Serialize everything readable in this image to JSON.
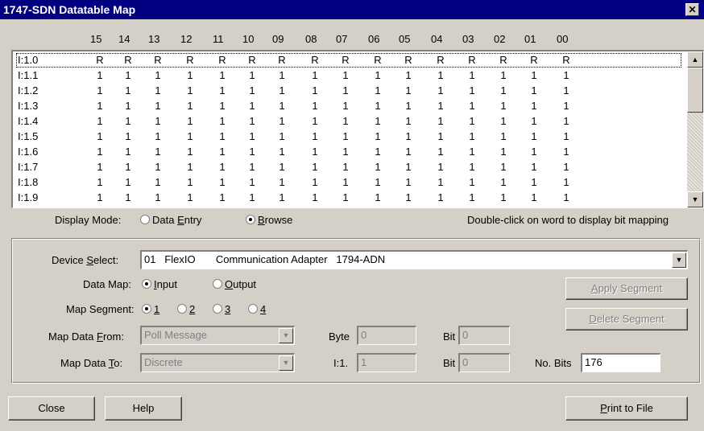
{
  "window": {
    "title": "1747-SDN Datatable Map",
    "close_glyph": "✕"
  },
  "bit_header": [
    "15",
    "14",
    "13",
    "12",
    "11",
    "10",
    "09",
    "08",
    "07",
    "06",
    "05",
    "04",
    "03",
    "02",
    "01",
    "00"
  ],
  "rows": [
    {
      "label": "I:1.0",
      "bits": [
        "R",
        "R",
        "R",
        "R",
        "R",
        "R",
        "R",
        "R",
        "R",
        "R",
        "R",
        "R",
        "R",
        "R",
        "R",
        "R"
      ]
    },
    {
      "label": "I:1.1",
      "bits": [
        "1",
        "1",
        "1",
        "1",
        "1",
        "1",
        "1",
        "1",
        "1",
        "1",
        "1",
        "1",
        "1",
        "1",
        "1",
        "1"
      ]
    },
    {
      "label": "I:1.2",
      "bits": [
        "1",
        "1",
        "1",
        "1",
        "1",
        "1",
        "1",
        "1",
        "1",
        "1",
        "1",
        "1",
        "1",
        "1",
        "1",
        "1"
      ]
    },
    {
      "label": "I:1.3",
      "bits": [
        "1",
        "1",
        "1",
        "1",
        "1",
        "1",
        "1",
        "1",
        "1",
        "1",
        "1",
        "1",
        "1",
        "1",
        "1",
        "1"
      ]
    },
    {
      "label": "I:1.4",
      "bits": [
        "1",
        "1",
        "1",
        "1",
        "1",
        "1",
        "1",
        "1",
        "1",
        "1",
        "1",
        "1",
        "1",
        "1",
        "1",
        "1"
      ]
    },
    {
      "label": "I:1.5",
      "bits": [
        "1",
        "1",
        "1",
        "1",
        "1",
        "1",
        "1",
        "1",
        "1",
        "1",
        "1",
        "1",
        "1",
        "1",
        "1",
        "1"
      ]
    },
    {
      "label": "I:1.6",
      "bits": [
        "1",
        "1",
        "1",
        "1",
        "1",
        "1",
        "1",
        "1",
        "1",
        "1",
        "1",
        "1",
        "1",
        "1",
        "1",
        "1"
      ]
    },
    {
      "label": "I:1.7",
      "bits": [
        "1",
        "1",
        "1",
        "1",
        "1",
        "1",
        "1",
        "1",
        "1",
        "1",
        "1",
        "1",
        "1",
        "1",
        "1",
        "1"
      ]
    },
    {
      "label": "I:1.8",
      "bits": [
        "1",
        "1",
        "1",
        "1",
        "1",
        "1",
        "1",
        "1",
        "1",
        "1",
        "1",
        "1",
        "1",
        "1",
        "1",
        "1"
      ]
    },
    {
      "label": "I:1.9",
      "bits": [
        "1",
        "1",
        "1",
        "1",
        "1",
        "1",
        "1",
        "1",
        "1",
        "1",
        "1",
        "1",
        "1",
        "1",
        "1",
        "1"
      ]
    }
  ],
  "display_mode": {
    "label": "Display Mode:",
    "option_data_entry_pre": "Data ",
    "option_data_entry_ul": "E",
    "option_data_entry_post": "ntry",
    "option_browse_pre": "",
    "option_browse_ul": "B",
    "option_browse_post": "rowse",
    "selected": "Browse",
    "hint": "Double-click on word to display bit mapping"
  },
  "device_select": {
    "label_pre": "Device ",
    "label_ul": "S",
    "label_post": "elect:",
    "value": "01   FlexIO       Communication Adapter   1794-ADN"
  },
  "data_map": {
    "label": "Data Map:",
    "input_ul": "I",
    "input_post": "nput",
    "output_ul": "O",
    "output_post": "utput",
    "selected": "Input"
  },
  "map_segment": {
    "label": "Map Segment:",
    "options": [
      "1",
      "2",
      "3",
      "4"
    ],
    "selected": "1"
  },
  "map_data_from": {
    "label_pre": "Map Data ",
    "label_ul": "F",
    "label_post": "rom:",
    "value": "Poll Message"
  },
  "map_data_to": {
    "label_pre": "Map Data ",
    "label_ul": "T",
    "label_post": "o:",
    "value": "Discrete"
  },
  "byte": {
    "label": "Byte",
    "value": "0"
  },
  "bit_from": {
    "label": "Bit",
    "value": "0"
  },
  "word": {
    "label": "I:1.",
    "value": "1"
  },
  "bit_to": {
    "label": "Bit",
    "value": "0"
  },
  "no_bits": {
    "label": "No. Bits",
    "value": "176"
  },
  "buttons": {
    "apply_ul": "A",
    "apply_post": "pply Segment",
    "delete_ul": "D",
    "delete_post": "elete Segment",
    "close": "Close",
    "help": "Help",
    "print_ul": "P",
    "print_post": "rint to File"
  },
  "icons": {
    "scroll_up": "▲",
    "scroll_down": "▼",
    "dropdown": "▼"
  }
}
